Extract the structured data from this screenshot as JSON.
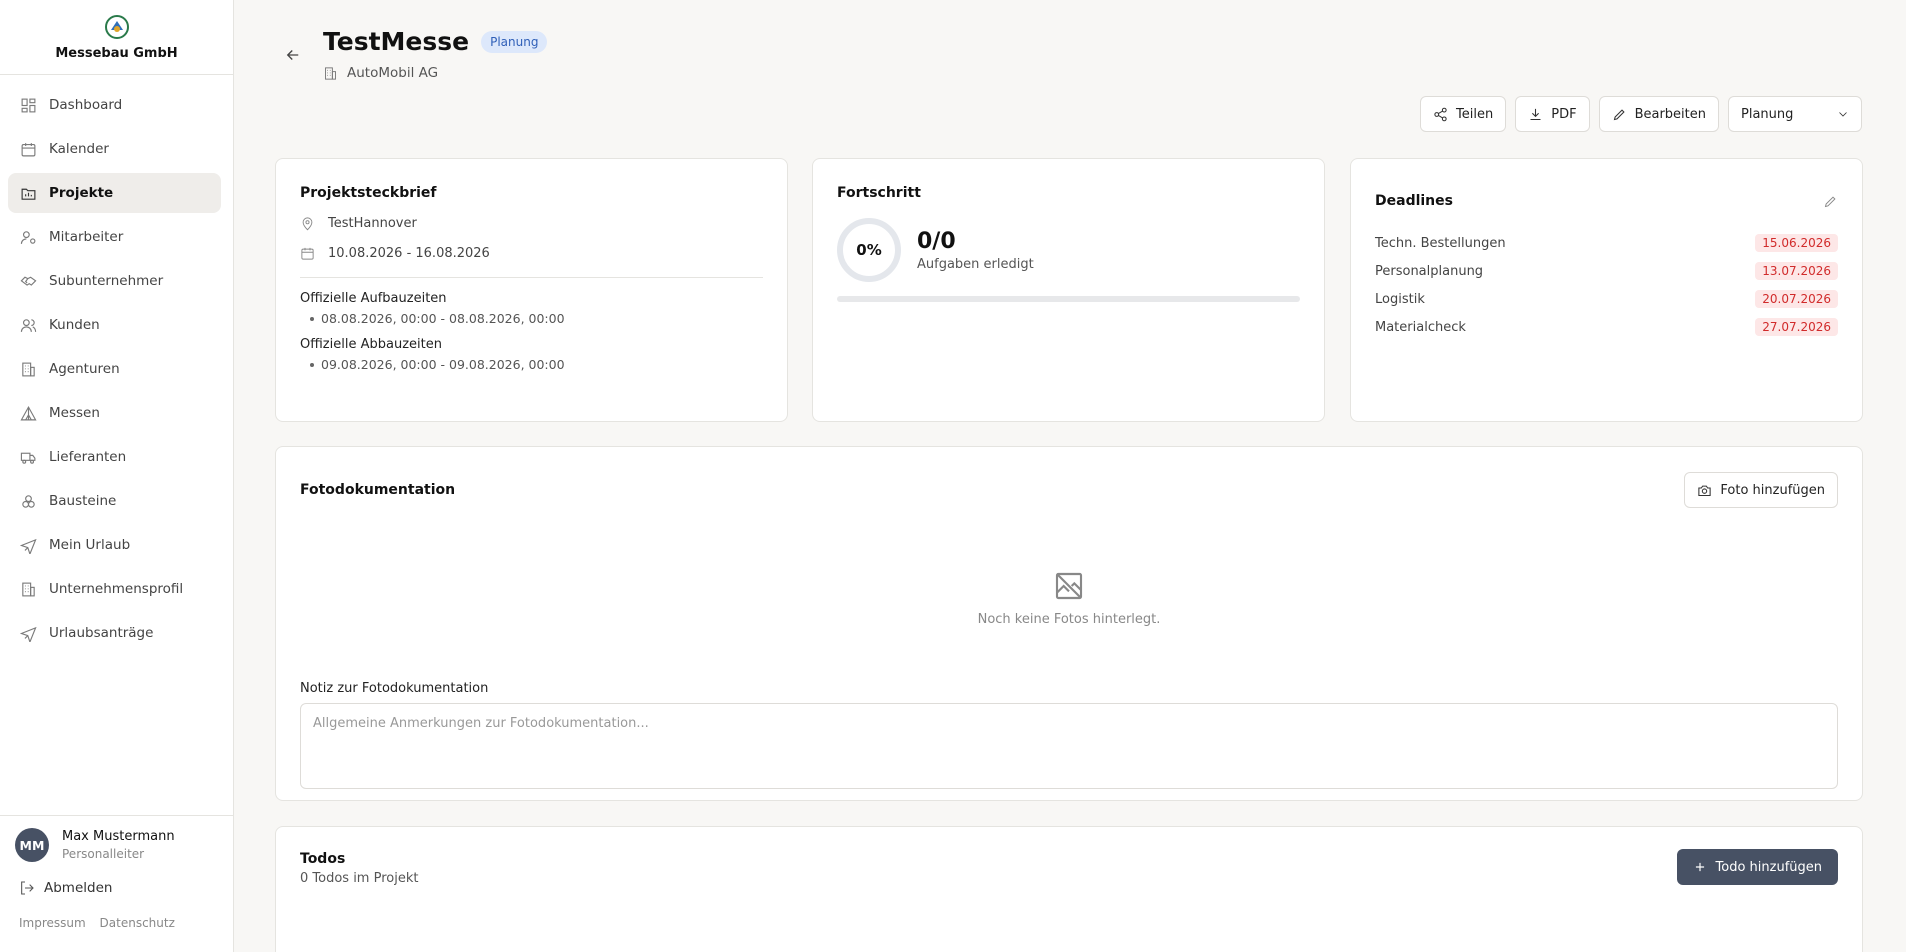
{
  "sidebar": {
    "company": "Messebau GmbH",
    "items": [
      {
        "label": "Dashboard",
        "icon": "dashboard-icon"
      },
      {
        "label": "Kalender",
        "icon": "calendar-icon"
      },
      {
        "label": "Projekte",
        "icon": "folder-icon"
      },
      {
        "label": "Mitarbeiter",
        "icon": "user-gear-icon"
      },
      {
        "label": "Subunternehmer",
        "icon": "handshake-icon"
      },
      {
        "label": "Kunden",
        "icon": "users-icon"
      },
      {
        "label": "Agenturen",
        "icon": "building-icon"
      },
      {
        "label": "Messen",
        "icon": "tent-icon"
      },
      {
        "label": "Lieferanten",
        "icon": "truck-icon"
      },
      {
        "label": "Bausteine",
        "icon": "blocks-icon"
      },
      {
        "label": "Mein Urlaub",
        "icon": "plane-icon"
      },
      {
        "label": "Unternehmensprofil",
        "icon": "building-icon"
      },
      {
        "label": "Urlaubsanträge",
        "icon": "plane-icon"
      }
    ],
    "user": {
      "initials": "MM",
      "name": "Max Mustermann",
      "role": "Personalleiter"
    },
    "logout": "Abmelden",
    "legal": {
      "imprint": "Impressum",
      "privacy": "Datenschutz"
    }
  },
  "header": {
    "title": "TestMesse",
    "status": "Planung",
    "customer": "AutoMobil AG"
  },
  "actions": {
    "share": "Teilen",
    "pdf": "PDF",
    "edit": "Bearbeiten",
    "status_select": "Planung"
  },
  "brief": {
    "title": "Projektsteckbrief",
    "location": "TestHannover",
    "dates": "10.08.2026 - 16.08.2026",
    "setup_title": "Offizielle Aufbauzeiten",
    "setup_items": [
      "08.08.2026, 00:00 - 08.08.2026, 00:00"
    ],
    "teardown_title": "Offizielle Abbauzeiten",
    "teardown_items": [
      "09.08.2026, 00:00 - 09.08.2026, 00:00"
    ]
  },
  "progress": {
    "title": "Fortschritt",
    "percent_label": "0%",
    "percent": 0,
    "count": "0/0",
    "label": "Aufgaben erledigt"
  },
  "deadlines": {
    "title": "Deadlines",
    "items": [
      {
        "name": "Techn. Bestellungen",
        "date": "15.06.2026"
      },
      {
        "name": "Personalplanung",
        "date": "13.07.2026"
      },
      {
        "name": "Logistik",
        "date": "20.07.2026"
      },
      {
        "name": "Materialcheck",
        "date": "27.07.2026"
      }
    ]
  },
  "photos": {
    "title": "Fotodokumentation",
    "add_button": "Foto hinzufügen",
    "empty_text": "Noch keine Fotos hinterlegt.",
    "note_label": "Notiz zur Fotodokumentation",
    "note_placeholder": "Allgemeine Anmerkungen zur Fotodokumentation..."
  },
  "todos": {
    "title": "Todos",
    "count_text": "0 Todos im Projekt",
    "add_button": "Todo hinzufügen"
  },
  "colors": {
    "accent_dark": "#475164",
    "badge_bg": "#dde8fb",
    "deadline_red": "#d12b2b"
  }
}
